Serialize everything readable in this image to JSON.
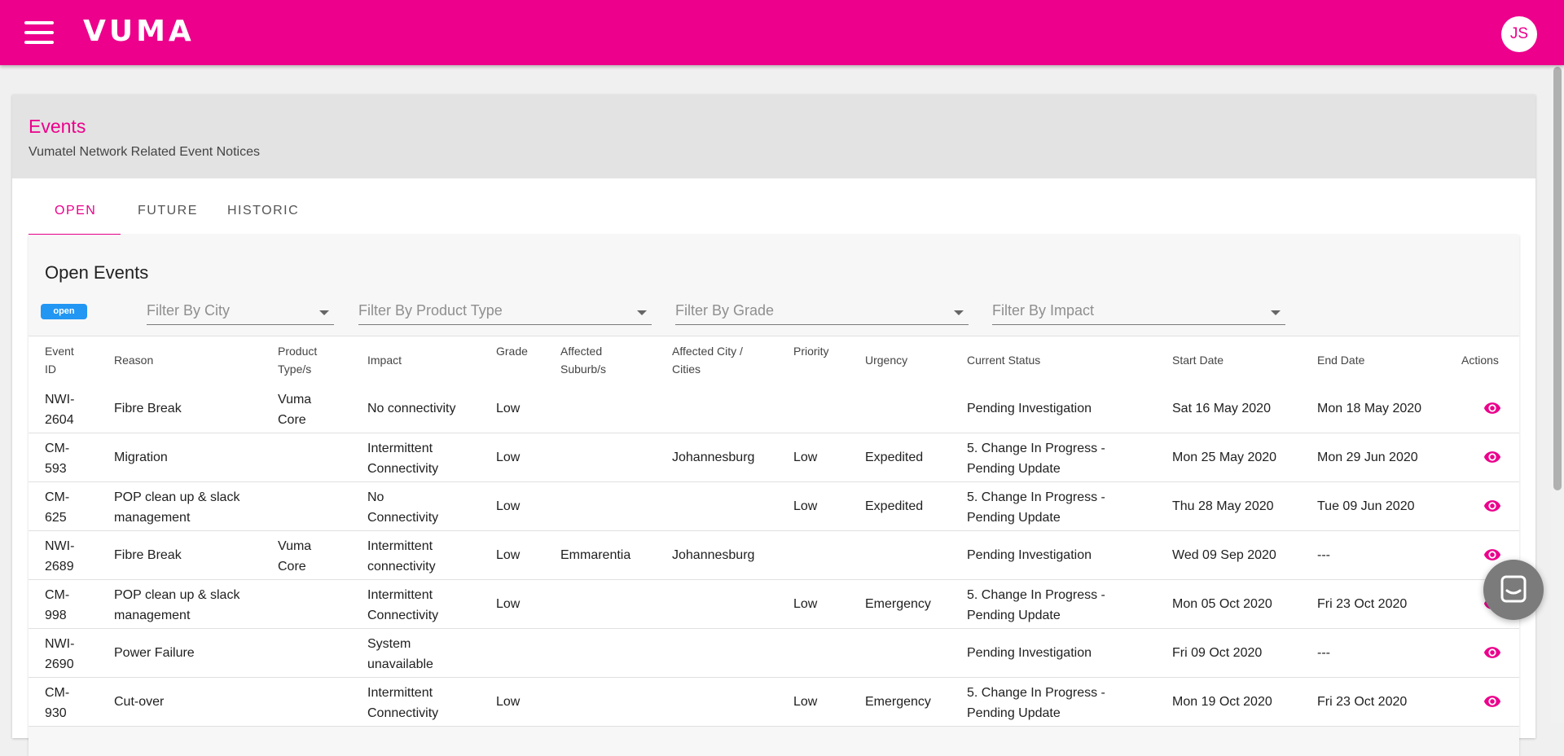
{
  "app": {
    "brand": "VUMA",
    "user_initials": "JS"
  },
  "page": {
    "title": "Events",
    "subtitle": "Vumatel Network Related Event Notices"
  },
  "tabs": [
    {
      "label": "OPEN",
      "active": true
    },
    {
      "label": "FUTURE",
      "active": false
    },
    {
      "label": "HISTORIC",
      "active": false
    }
  ],
  "panel": {
    "title": "Open Events",
    "badge": "open",
    "filters": {
      "city": "Filter By City",
      "product_type": "Filter By Product Type",
      "grade": "Filter By Grade",
      "impact": "Filter By Impact"
    }
  },
  "table": {
    "headers": {
      "event_id": "Event ID",
      "reason": "Reason",
      "product_type": "Product Type/s",
      "impact": "Impact",
      "grade": "Grade",
      "affected_suburbs": "Affected Suburb/s",
      "affected_cities": "Affected City / Cities",
      "priority": "Priority",
      "urgency": "Urgency",
      "current_status": "Current Status",
      "start_date": "Start Date",
      "end_date": "End Date",
      "actions": "Actions"
    },
    "rows": [
      {
        "event_id": "NWI-2604",
        "reason": "Fibre Break",
        "product_type": "Vuma Core",
        "impact": "No connectivity",
        "grade": "Low",
        "suburb": "",
        "city": "",
        "priority": "",
        "urgency": "",
        "status": "Pending Investigation",
        "start": "Sat 16 May 2020",
        "end": "Mon 18 May 2020"
      },
      {
        "event_id": "CM-593",
        "reason": "Migration",
        "product_type": "",
        "impact": "Intermittent Connectivity",
        "grade": "Low",
        "suburb": "",
        "city": "Johannesburg",
        "priority": "Low",
        "urgency": "Expedited",
        "status": "5. Change In Progress - Pending Update",
        "start": "Mon 25 May 2020",
        "end": "Mon 29 Jun 2020"
      },
      {
        "event_id": "CM-625",
        "reason": "POP clean up & slack management",
        "product_type": "",
        "impact": "No Connectivity",
        "grade": "Low",
        "suburb": "",
        "city": "",
        "priority": "Low",
        "urgency": "Expedited",
        "status": "5. Change In Progress - Pending Update",
        "start": "Thu 28 May 2020",
        "end": "Tue 09 Jun 2020"
      },
      {
        "event_id": "NWI-2689",
        "reason": "Fibre Break",
        "product_type": "Vuma Core",
        "impact": "Intermittent connectivity",
        "grade": "Low",
        "suburb": "Emmarentia",
        "city": "Johannesburg",
        "priority": "",
        "urgency": "",
        "status": "Pending Investigation",
        "start": "Wed 09 Sep 2020",
        "end": "---"
      },
      {
        "event_id": "CM-998",
        "reason": "POP clean up & slack management",
        "product_type": "",
        "impact": "Intermittent Connectivity",
        "grade": "Low",
        "suburb": "",
        "city": "",
        "priority": "Low",
        "urgency": "Emergency",
        "status": "5. Change In Progress - Pending Update",
        "start": "Mon 05 Oct 2020",
        "end": "Fri 23 Oct 2020"
      },
      {
        "event_id": "NWI-2690",
        "reason": "Power Failure",
        "product_type": "",
        "impact": "System unavailable",
        "grade": "",
        "suburb": "",
        "city": "",
        "priority": "",
        "urgency": "",
        "status": "Pending Investigation",
        "start": "Fri 09 Oct 2020",
        "end": "---"
      },
      {
        "event_id": "CM-930",
        "reason": "Cut-over",
        "product_type": "",
        "impact": "Intermittent Connectivity",
        "grade": "Low",
        "suburb": "",
        "city": "",
        "priority": "Low",
        "urgency": "Emergency",
        "status": "5. Change In Progress - Pending Update",
        "start": "Mon 19 Oct 2020",
        "end": "Fri 23 Oct 2020"
      }
    ]
  },
  "colors": {
    "brand": "#ec008c",
    "badge": "#2196f3",
    "chat": "#7b7b7b"
  },
  "icons": {
    "menu": "hamburger-icon",
    "view": "eye-icon",
    "chat": "chat-icon"
  }
}
